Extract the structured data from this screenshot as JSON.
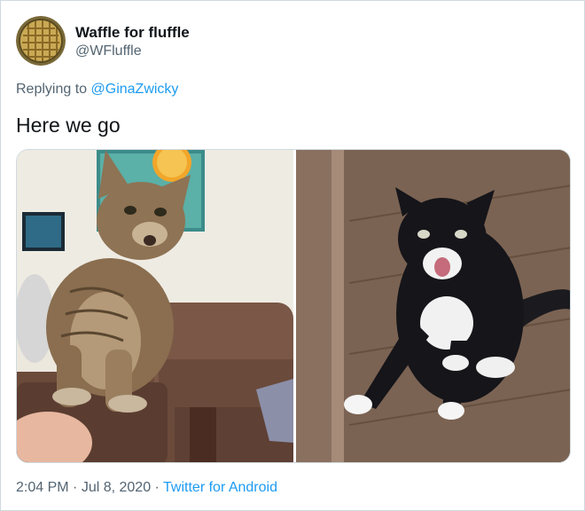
{
  "author": {
    "display_name": "Waffle for fluffle",
    "handle": "@WFluffle",
    "avatar_icon": "waffle-avatar-icon"
  },
  "reply": {
    "prefix": "Replying to ",
    "mention": "@GinaZwicky"
  },
  "tweet": {
    "text": "Here we go"
  },
  "media": [
    {
      "kind": "photo",
      "subject": "tabby cat sitting on armchair"
    },
    {
      "kind": "photo",
      "subject": "black and white cat on wooden floor"
    }
  ],
  "meta": {
    "time": "2:04 PM",
    "separator": " · ",
    "date": "Jul 8, 2020",
    "source": "Twitter for Android"
  },
  "colors": {
    "link": "#1d9bf0",
    "secondary_text": "#536471",
    "border": "#cfd9de"
  }
}
